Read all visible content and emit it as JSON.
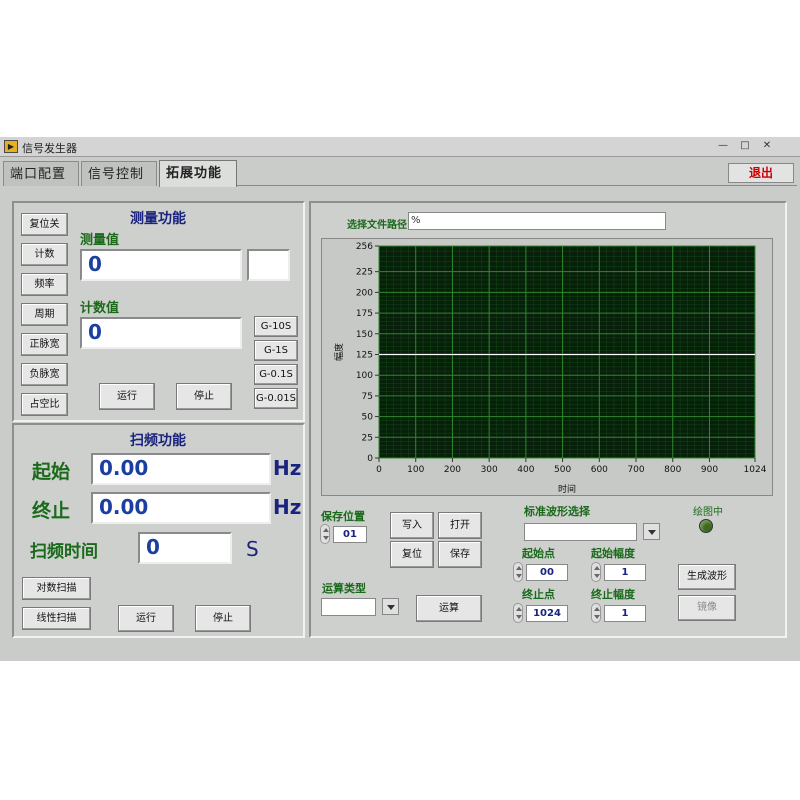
{
  "window": {
    "title": "信号发生器",
    "icon": "labview-icon",
    "min_glyph": "—",
    "max_glyph": "□",
    "close_glyph": "✕"
  },
  "tabs": [
    {
      "label": "端口配置",
      "active": false
    },
    {
      "label": "信号控制",
      "active": false
    },
    {
      "label": "拓展功能",
      "active": true
    }
  ],
  "exit_label": "退出",
  "measure": {
    "title": "测量功能",
    "buttons": [
      "复位关",
      "计数",
      "频率",
      "周期",
      "正脉宽",
      "负脉宽",
      "占空比"
    ],
    "value_label": "测量值",
    "value": "0",
    "unit_value": "",
    "count_label": "计数值",
    "count": "0",
    "gate_buttons": [
      "G-10S",
      "G-1S",
      "G-0.1S",
      "G-0.01S"
    ],
    "run_label": "运行",
    "stop_label": "停止"
  },
  "sweep": {
    "title": "扫频功能",
    "start_label": "起始",
    "start_value": "0.00",
    "start_unit": "Hz",
    "end_label": "终止",
    "end_value": "0.00",
    "end_unit": "Hz",
    "time_label": "扫频时间",
    "time_value": "0",
    "time_unit": "S",
    "log_sweep_label": "对数扫描",
    "linear_sweep_label": "线性扫描",
    "run_label": "运行",
    "stop_label": "停止"
  },
  "waveform": {
    "path_label": "选择文件路径",
    "path_value": "",
    "path_icon": "%",
    "save_pos_label": "保存位置",
    "save_pos_value": "01",
    "write_label": "写入",
    "open_label": "打开",
    "reset_label": "复位",
    "save_label": "保存",
    "std_wave_label": "标准波形选择",
    "std_wave_value": "",
    "start_point_label": "起始点",
    "start_point_value": "00",
    "start_amp_label": "起始幅度",
    "start_amp_value": "1",
    "end_point_label": "终止点",
    "end_point_value": "1024",
    "end_amp_label": "终止幅度",
    "end_amp_value": "1",
    "op_type_label": "运算类型",
    "op_type_value": "",
    "compute_label": "运算",
    "drawing_label": "绘图中",
    "generate_label": "生成波形",
    "mirror_label": "镜像",
    "led_color": "#3a6b1a"
  },
  "chart_data": {
    "type": "line",
    "title": "",
    "xlabel": "时间",
    "ylabel": "幅度",
    "xlim": [
      0,
      1024
    ],
    "ylim": [
      0,
      256
    ],
    "x_ticks": [
      0,
      100,
      200,
      300,
      400,
      500,
      600,
      700,
      800,
      900,
      1024
    ],
    "y_ticks": [
      0,
      25,
      50,
      75,
      100,
      125,
      150,
      175,
      200,
      225,
      256
    ],
    "grid": true,
    "background": "#07200a",
    "grid_color": "#2d8a2d",
    "line_color": "#ffffff",
    "series": [
      {
        "x": [
          0,
          1024
        ],
        "y": [
          125,
          125
        ]
      }
    ]
  }
}
